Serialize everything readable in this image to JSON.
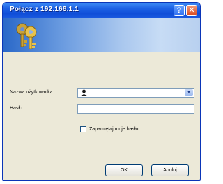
{
  "window": {
    "title": "Połącz z 192.168.1.1",
    "help_glyph": "?",
    "close_glyph": "✕"
  },
  "form": {
    "username_label": "Nazwa użytkownika:",
    "password_label": "Hasło:",
    "remember_label": "Zapamiętaj moje hasło",
    "username_value": "",
    "password_value": "",
    "combo_arrow": "▼"
  },
  "buttons": {
    "ok_label": "OK",
    "cancel_label": "Anuluj"
  },
  "icons": {
    "banner": "keys-icon",
    "user": "user-icon",
    "help": "help-icon",
    "close": "close-icon"
  },
  "colors": {
    "titlebar": "#1f63e6",
    "dialog_bg": "#ece9d8",
    "field_border": "#7f9db9"
  }
}
